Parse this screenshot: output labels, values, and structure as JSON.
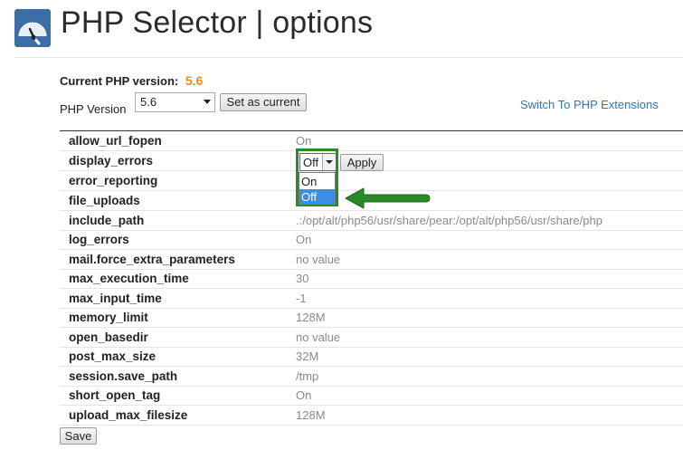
{
  "header": {
    "title": "PHP Selector | options",
    "logo_icon": "php-gauge-logo"
  },
  "current_version": {
    "label": "Current PHP version:",
    "value": "5.6",
    "value_color": "#ec8a1c"
  },
  "version_select": {
    "label": "PHP Version",
    "selected": "5.6",
    "set_button": "Set as current"
  },
  "switch_link": "Switch To PHP Extensions",
  "options": [
    {
      "name": "allow_url_fopen",
      "value": "On"
    },
    {
      "name": "display_errors",
      "value": ""
    },
    {
      "name": "error_reporting",
      "value": ""
    },
    {
      "name": "file_uploads",
      "value": ""
    },
    {
      "name": "include_path",
      "value": ".:/opt/alt/php56/usr/share/pear:/opt/alt/php56/usr/share/php"
    },
    {
      "name": "log_errors",
      "value": "On"
    },
    {
      "name": "mail.force_extra_parameters",
      "value": "no value"
    },
    {
      "name": "max_execution_time",
      "value": "30"
    },
    {
      "name": "max_input_time",
      "value": "-1"
    },
    {
      "name": "memory_limit",
      "value": "128M"
    },
    {
      "name": "open_basedir",
      "value": "no value"
    },
    {
      "name": "post_max_size",
      "value": "32M"
    },
    {
      "name": "session.save_path",
      "value": "/tmp"
    },
    {
      "name": "short_open_tag",
      "value": "On"
    },
    {
      "name": "upload_max_filesize",
      "value": "128M"
    }
  ],
  "display_errors_control": {
    "selected": "Off",
    "options": [
      "On",
      "Off"
    ],
    "highlighted": "Off",
    "apply_button": "Apply",
    "highlight_color": "#2a8a2a"
  },
  "save_button": "Save"
}
